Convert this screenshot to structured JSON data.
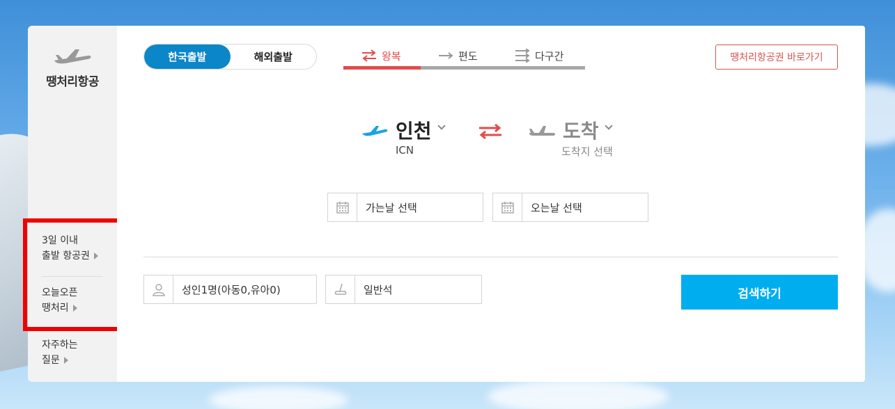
{
  "brand": {
    "name": "땡처리항공"
  },
  "sidebar": {
    "items": [
      {
        "line1": "3일 이내",
        "line2": "출발 항공권"
      },
      {
        "line1": "오늘오픈",
        "line2": "땡처리"
      },
      {
        "line1": "자주하는",
        "line2": "질문"
      }
    ]
  },
  "origin_toggle": {
    "domestic": "한국출발",
    "overseas": "해외출발",
    "selected": "domestic"
  },
  "trip_tabs": {
    "items": [
      {
        "label": "왕복",
        "icon": "round-trip-icon",
        "active": true
      },
      {
        "label": "편도",
        "icon": "one-way-icon",
        "active": false
      },
      {
        "label": "다구간",
        "icon": "multi-city-icon",
        "active": false
      }
    ]
  },
  "shortcut": {
    "label": "땡처리항공권 바로가기"
  },
  "route": {
    "departure": {
      "city": "인천",
      "code": "ICN"
    },
    "arrival": {
      "city": "도착",
      "code": "도착지 선택"
    }
  },
  "dates": {
    "depart_placeholder": "가는날 선택",
    "return_placeholder": "오는날 선택"
  },
  "passengers": {
    "label": "성인1명(아동0,유아0)"
  },
  "cabin": {
    "label": "일반석"
  },
  "search": {
    "label": "검색하기"
  },
  "colors": {
    "accent_blue": "#0b86c8",
    "search_blue": "#00aeef",
    "accent_red": "#e34b4b",
    "highlight_red": "#f00000"
  }
}
